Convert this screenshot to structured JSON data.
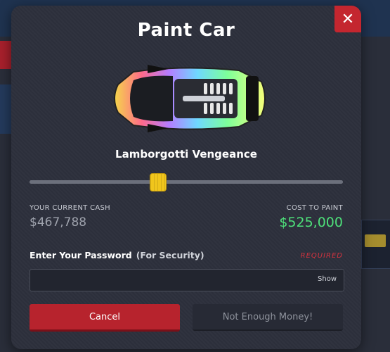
{
  "modal": {
    "title": "Paint Car",
    "close_glyph": "✕",
    "car_name": "Lamborgotti Vengeance",
    "slider_value_fraction": 0.41,
    "cash": {
      "label": "YOUR CURRENT CASH",
      "value": "$467,788"
    },
    "cost": {
      "label": "COST TO PAINT",
      "value": "$525,000"
    },
    "password": {
      "label": "Enter Your Password",
      "hint": "(For Security)",
      "required_text": "REQUIRED",
      "value": "",
      "show_label": "Show"
    },
    "buttons": {
      "cancel": "Cancel",
      "not_enough": "Not Enough Money!"
    },
    "colors": {
      "close": "#c4262f",
      "cancel": "#b7232d",
      "cost_text": "#4ee07a",
      "slider_thumb": "#f0c51c",
      "required_text": "#d3333f"
    },
    "icons": {
      "close": "close-icon",
      "car": "car-image"
    }
  }
}
